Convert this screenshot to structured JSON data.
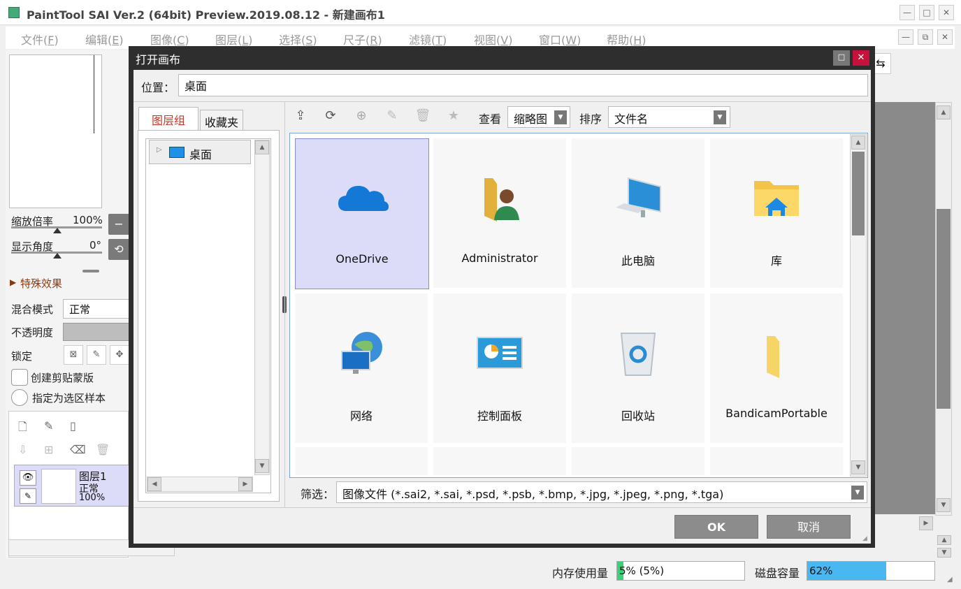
{
  "app": {
    "title": "PaintTool SAI Ver.2 (64bit) Preview.2019.08.12 - 新建画布1"
  },
  "menu": [
    {
      "label": "文件(",
      "key": "F",
      "tail": ")"
    },
    {
      "label": "编辑(",
      "key": "E",
      "tail": ")"
    },
    {
      "label": "图像(",
      "key": "C",
      "tail": ")"
    },
    {
      "label": "图层(",
      "key": "L",
      "tail": ")"
    },
    {
      "label": "选择(",
      "key": "S",
      "tail": ")"
    },
    {
      "label": "尺子(",
      "key": "R",
      "tail": ")"
    },
    {
      "label": "滤镜(",
      "key": "T",
      "tail": ")"
    },
    {
      "label": "视图(",
      "key": "V",
      "tail": ")"
    },
    {
      "label": "窗口(",
      "key": "W",
      "tail": ")"
    },
    {
      "label": "帮助(",
      "key": "H",
      "tail": ")"
    }
  ],
  "left": {
    "zoom_label": "缩放倍率",
    "zoom_value": "100%",
    "angle_label": "显示角度",
    "angle_value": "0°",
    "effects": "特殊效果",
    "blend_label": "混合模式",
    "blend_value": "正常",
    "opacity_label": "不透明度",
    "lock_label": "锁定",
    "clip_label": "创建剪贴蒙版",
    "sample_label": "指定为选区样本",
    "layer": {
      "name": "图层1",
      "mode": "正常",
      "opacity": "100%"
    }
  },
  "bottom": {
    "mem_label": "内存使用量",
    "mem_value": "5% (5%)",
    "mem_pct": 0.05,
    "disk_label": "磁盘容量",
    "disk_value": "62%",
    "disk_pct": 0.62
  },
  "dialog": {
    "title": "打开画布",
    "location_label": "位置：",
    "location_value": "桌面",
    "tabs": [
      "图层组",
      "收藏夹"
    ],
    "tree_item": "桌面",
    "view_label": "查看",
    "view_value": "缩略图",
    "sort_label": "排序",
    "sort_value": "文件名",
    "items": [
      "OneDrive",
      "Administrator",
      "此电脑",
      "库",
      "网络",
      "控制面板",
      "回收站",
      "BandicamPortable"
    ],
    "filter_label": "筛选：",
    "filter_value": "图像文件 (*.sai2, *.sai, *.psd, *.psb, *.bmp, *.jpg, *.jpeg, *.png, *.tga)",
    "ok": "OK",
    "cancel": "取消"
  }
}
